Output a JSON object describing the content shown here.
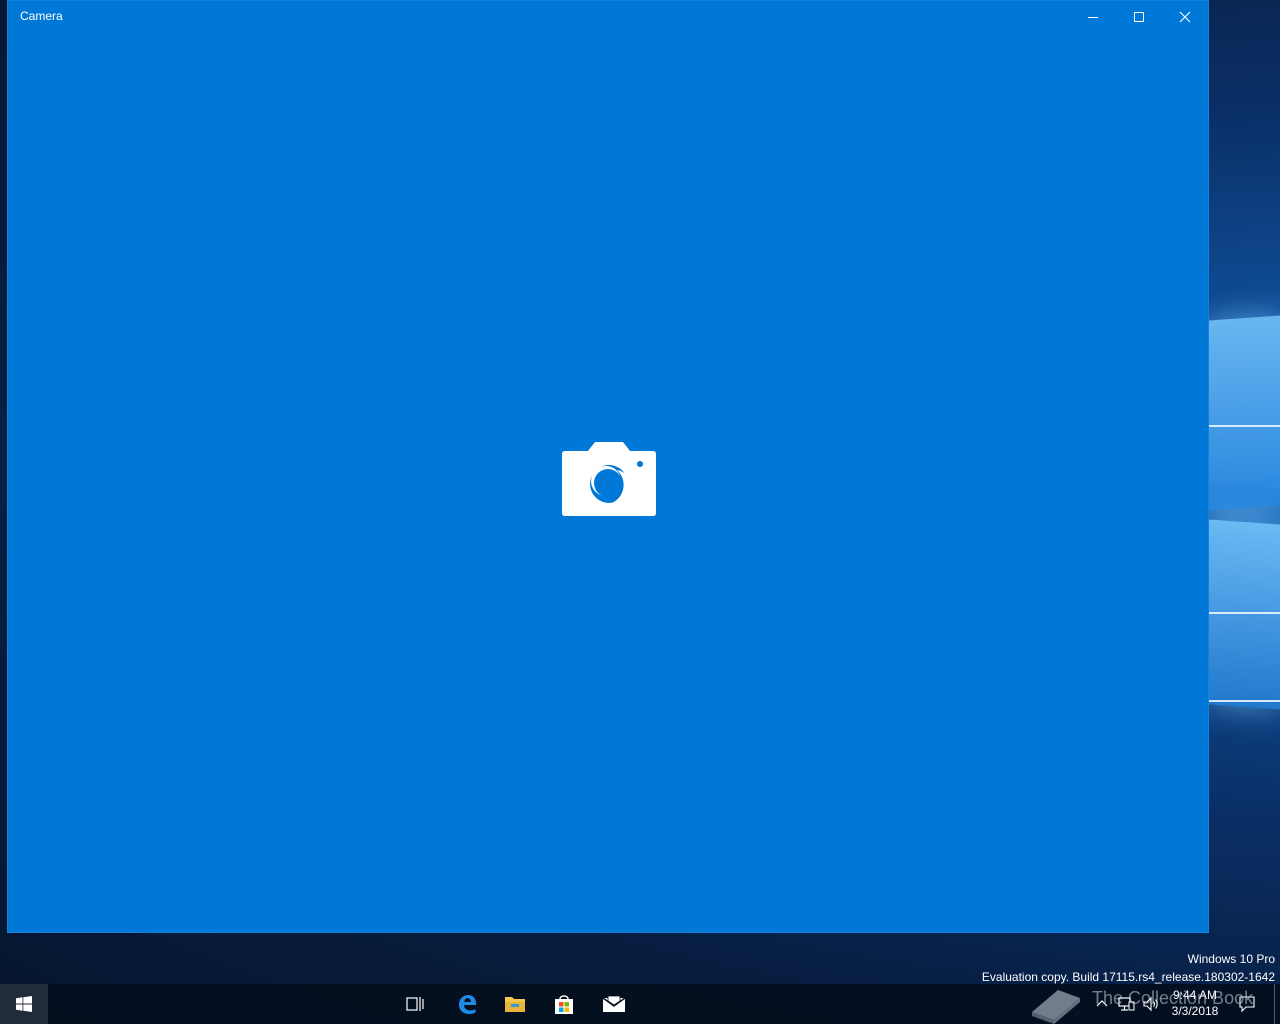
{
  "window": {
    "title": "Camera",
    "background": "#0078d7",
    "controls": {
      "minimize": "minimize-icon",
      "maximize": "maximize-icon",
      "close": "close-icon"
    }
  },
  "splash": {
    "icon": "camera-icon"
  },
  "desktop_watermark": {
    "edition": "Windows 10 Pro",
    "build": "Evaluation copy. Build 17115.rs4_release.180302-1642"
  },
  "taskbar": {
    "pinned_apps": [
      "start-icon",
      "task-view-icon",
      "edge-icon",
      "file-explorer-icon",
      "store-icon",
      "mail-icon"
    ],
    "tray_icons": [
      "chevron-up-icon",
      "network-icon",
      "volume-icon",
      "action-center-icon"
    ],
    "clock": {
      "time": "9:44 AM",
      "date": "3/3/2018"
    }
  },
  "site_watermark": {
    "text": "The Collection Book"
  }
}
